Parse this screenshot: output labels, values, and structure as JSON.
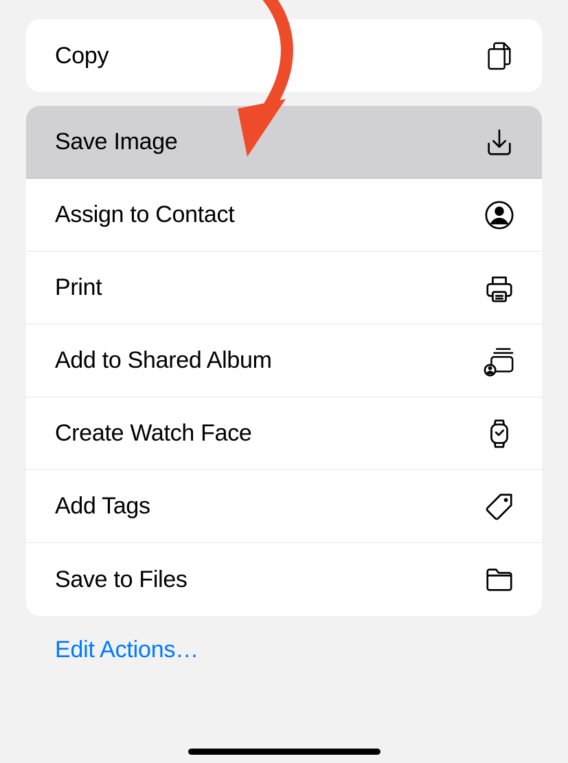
{
  "actions": {
    "copy": {
      "label": "Copy"
    },
    "save_image": {
      "label": "Save Image"
    },
    "assign_to_contact": {
      "label": "Assign to Contact"
    },
    "print": {
      "label": "Print"
    },
    "add_to_shared_album": {
      "label": "Add to Shared Album"
    },
    "create_watch_face": {
      "label": "Create Watch Face"
    },
    "add_tags": {
      "label": "Add Tags"
    },
    "save_to_files": {
      "label": "Save to Files"
    }
  },
  "edit_actions_label": "Edit Actions…",
  "annotation": {
    "arrow_color": "#ee4b2b",
    "highlighted_row": "save_image"
  }
}
